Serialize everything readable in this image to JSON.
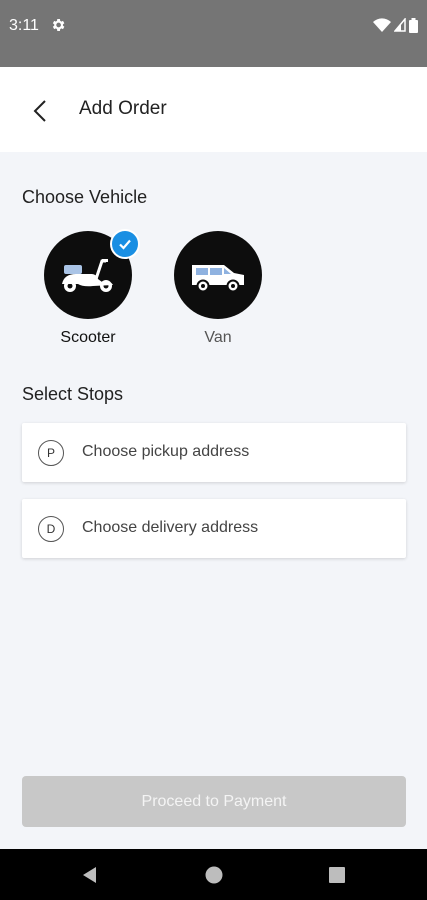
{
  "status_bar": {
    "time": "3:11",
    "icons": [
      "settings-icon",
      "wifi-icon",
      "signal-icon",
      "battery-icon"
    ]
  },
  "header": {
    "title": "Add Order",
    "back_icon": "back-arrow-icon"
  },
  "vehicle_section": {
    "title": "Choose Vehicle",
    "vehicles": [
      {
        "label": "Scooter",
        "icon": "scooter-icon",
        "selected": true
      },
      {
        "label": "Van",
        "icon": "van-icon",
        "selected": false
      }
    ]
  },
  "stops_section": {
    "title": "Select Stops",
    "stops": [
      {
        "badge": "P",
        "placeholder": "Choose pickup address"
      },
      {
        "badge": "D",
        "placeholder": "Choose delivery address"
      }
    ]
  },
  "footer": {
    "proceed_label": "Proceed to Payment"
  },
  "nav_bar": {
    "icons": [
      "nav-back-icon",
      "nav-home-icon",
      "nav-recents-icon"
    ]
  },
  "colors": {
    "accent": "#1a8fe3",
    "status_bar": "#757575",
    "disabled_button": "#c8c8c8",
    "background": "#f3f5f9"
  }
}
